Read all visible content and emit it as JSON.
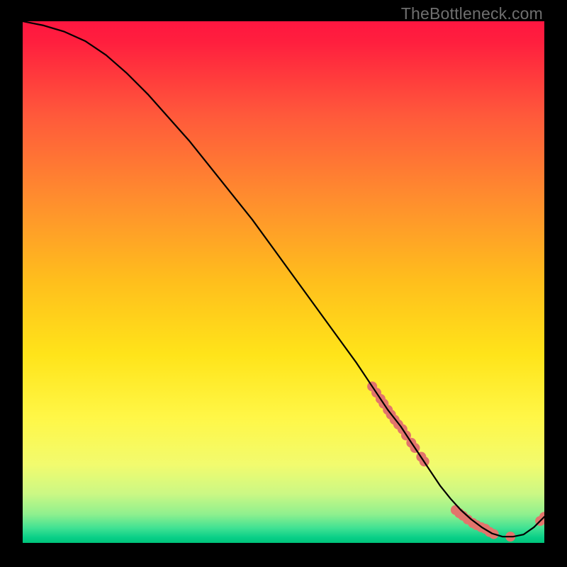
{
  "watermark": "TheBottleneck.com",
  "colors": {
    "black": "#000000",
    "line": "#000000",
    "dot": "#e2746c",
    "grad_top": "#ff1640",
    "grad_mid": "#ffd400",
    "grad_green_light": "#b3f58a",
    "grad_green_mid": "#2de08c",
    "grad_green_deep": "#00c47a"
  },
  "chart_data": {
    "type": "line",
    "title": "",
    "xlabel": "",
    "ylabel": "",
    "xlim": [
      0,
      100
    ],
    "ylim": [
      0,
      100
    ],
    "series": [
      {
        "name": "curve",
        "style": "line",
        "color": "#000000",
        "x": [
          0,
          4,
          8,
          12,
          16,
          20,
          24,
          28,
          32,
          36,
          40,
          44,
          48,
          52,
          56,
          60,
          64,
          67,
          70,
          72.5,
          74,
          76,
          78,
          80,
          82,
          84,
          86,
          88,
          90,
          92,
          94,
          96,
          98,
          100
        ],
        "values": [
          100,
          99.2,
          98,
          96.2,
          93.5,
          90,
          86,
          81.5,
          77,
          72,
          67,
          62,
          56.5,
          51,
          45.5,
          40,
          34.5,
          30,
          25.5,
          22.3,
          20,
          17,
          14,
          11,
          8.5,
          6.3,
          4.5,
          3.0,
          1.8,
          1.2,
          1.2,
          1.6,
          3.0,
          5.0
        ]
      },
      {
        "name": "upper-cluster",
        "style": "dots",
        "color": "#e2746c",
        "points": [
          {
            "x": 67.0,
            "y": 30.0
          },
          {
            "x": 67.8,
            "y": 28.8
          },
          {
            "x": 68.6,
            "y": 27.6
          },
          {
            "x": 69.2,
            "y": 26.7
          },
          {
            "x": 70.0,
            "y": 25.5
          },
          {
            "x": 70.6,
            "y": 24.6
          },
          {
            "x": 71.3,
            "y": 23.6
          },
          {
            "x": 72.0,
            "y": 22.7
          },
          {
            "x": 72.8,
            "y": 21.8
          },
          {
            "x": 73.5,
            "y": 20.6
          },
          {
            "x": 74.5,
            "y": 19.2
          },
          {
            "x": 75.2,
            "y": 18.2
          },
          {
            "x": 76.4,
            "y": 16.5
          },
          {
            "x": 77.0,
            "y": 15.6
          }
        ]
      },
      {
        "name": "floor-cluster",
        "style": "dots",
        "color": "#e2746c",
        "points": [
          {
            "x": 83.0,
            "y": 6.3
          },
          {
            "x": 83.7,
            "y": 5.7
          },
          {
            "x": 84.4,
            "y": 5.2
          },
          {
            "x": 85.3,
            "y": 4.5
          },
          {
            "x": 86.3,
            "y": 3.8
          },
          {
            "x": 87.0,
            "y": 3.4
          },
          {
            "x": 87.9,
            "y": 3.0
          },
          {
            "x": 88.7,
            "y": 2.7
          },
          {
            "x": 89.5,
            "y": 2.1
          },
          {
            "x": 90.3,
            "y": 1.7
          },
          {
            "x": 93.5,
            "y": 1.2
          }
        ]
      },
      {
        "name": "tail-dots",
        "style": "dots",
        "color": "#e2746c",
        "points": [
          {
            "x": 99.2,
            "y": 4.2
          },
          {
            "x": 100.0,
            "y": 5.0
          }
        ]
      }
    ]
  }
}
